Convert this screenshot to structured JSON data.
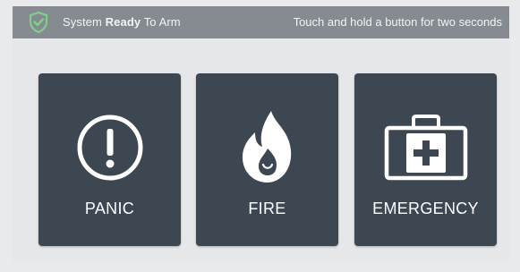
{
  "header": {
    "status_prefix": "System",
    "status_ready": "Ready",
    "status_suffix": "To Arm",
    "hint": "Touch and hold a button for two seconds",
    "shield_icon": "shield-check-icon",
    "shield_color": "#7ed08a"
  },
  "buttons": [
    {
      "label": "PANIC",
      "icon": "exclamation-circle-icon"
    },
    {
      "label": "FIRE",
      "icon": "flame-icon"
    },
    {
      "label": "EMERGENCY",
      "icon": "medical-kit-icon"
    }
  ],
  "colors": {
    "topbar": "#868b91",
    "background": "#e9eaeb",
    "button": "#3d4752"
  }
}
